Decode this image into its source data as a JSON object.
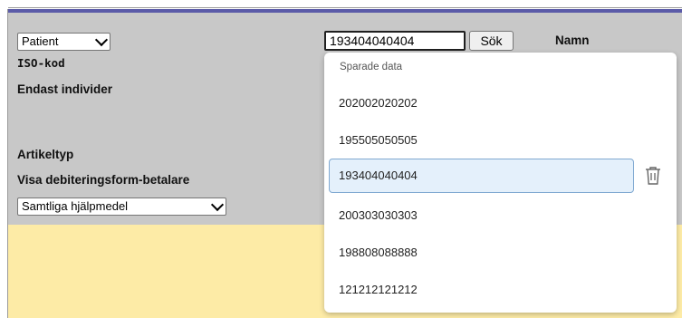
{
  "form": {
    "type_select": {
      "value": "Patient"
    },
    "labels": {
      "iso": "ISO-kod",
      "individuals": "Endast individer",
      "article_type": "Artikeltyp",
      "billing": "Visa debiteringsform-betalare"
    },
    "aid_select": {
      "value": "Samtliga hjälpmedel"
    },
    "search": {
      "value": "193404040404",
      "button_label": "Sök"
    },
    "name_label": "Namn"
  },
  "autocomplete": {
    "header": "Sparade data",
    "items": [
      "202002020202",
      "195505050505",
      "193404040404",
      "200303030303",
      "198808088888",
      "121212121212"
    ],
    "selected_index": 2
  },
  "colors": {
    "top_bar": "#5b5ba8",
    "form_background": "#c8c8c8",
    "results_background": "#fdeba6",
    "selected_item": "#e4f0fb"
  }
}
